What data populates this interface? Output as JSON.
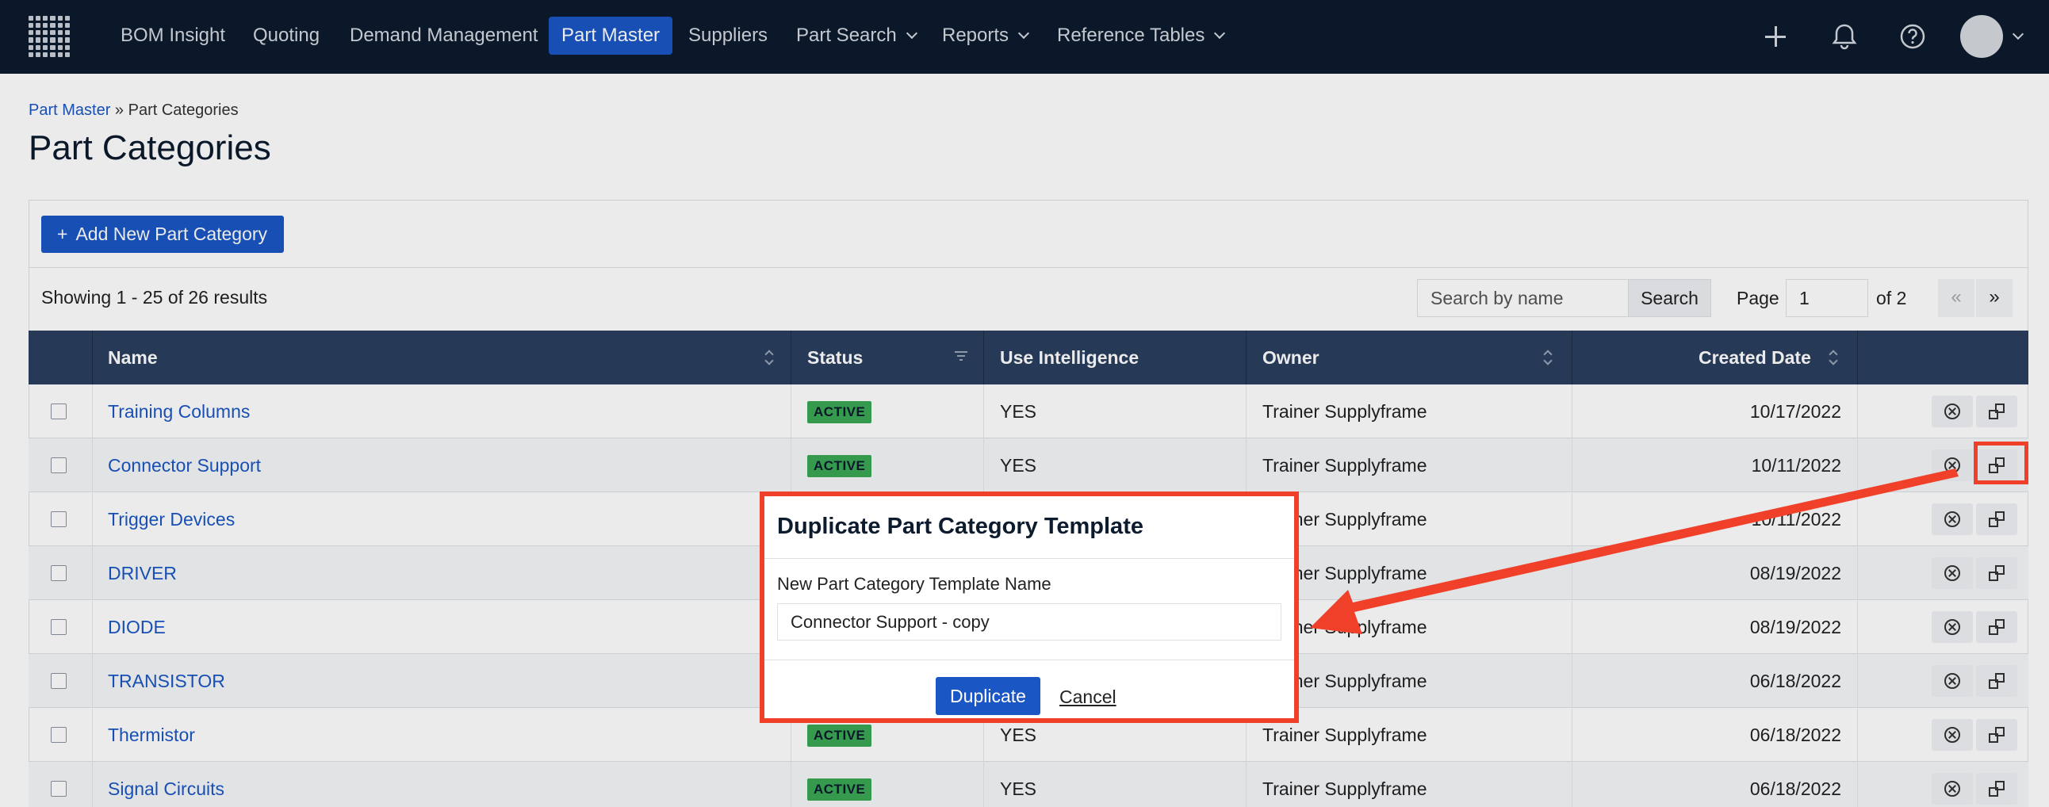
{
  "nav": {
    "items": [
      {
        "label": "BOM Insight",
        "dropdown": false,
        "active": false
      },
      {
        "label": "Quoting",
        "dropdown": false,
        "active": false
      },
      {
        "label": "Demand Management",
        "dropdown": false,
        "active": false
      },
      {
        "label": "Part Master",
        "dropdown": false,
        "active": true
      },
      {
        "label": "Suppliers",
        "dropdown": false,
        "active": false
      },
      {
        "label": "Part Search",
        "dropdown": true,
        "active": false
      },
      {
        "label": "Reports",
        "dropdown": true,
        "active": false
      },
      {
        "label": "Reference Tables",
        "dropdown": true,
        "active": false
      }
    ],
    "icons": [
      "plus-icon",
      "bell-icon",
      "help-icon",
      "avatar"
    ]
  },
  "breadcrumb": {
    "parent": "Part Master",
    "separator": "»",
    "current": "Part Categories"
  },
  "page": {
    "title": "Part Categories"
  },
  "toolbar": {
    "add_label": "Add New Part Category",
    "results": "Showing 1 - 25 of 26 results",
    "search_placeholder": "Search by name",
    "search_label": "Search",
    "page_label": "Page",
    "page_value": "1",
    "of_label": "of 2",
    "prev_label": "«",
    "next_label": "»"
  },
  "table": {
    "headers": {
      "name": "Name",
      "status": "Status",
      "use_intelligence": "Use Intelligence",
      "owner": "Owner",
      "created": "Created Date"
    },
    "rows": [
      {
        "name": "Training Columns",
        "status": "ACTIVE",
        "use_intelligence": "YES",
        "owner": "Trainer Supplyframe",
        "created": "10/17/2022"
      },
      {
        "name": "Connector Support",
        "status": "ACTIVE",
        "use_intelligence": "YES",
        "owner": "Trainer Supplyframe",
        "created": "10/11/2022"
      },
      {
        "name": "Trigger Devices",
        "status": "",
        "use_intelligence": "",
        "owner": "Trainer Supplyframe",
        "created": "10/11/2022"
      },
      {
        "name": "DRIVER",
        "status": "",
        "use_intelligence": "",
        "owner": "Trainer Supplyframe",
        "created": "08/19/2022"
      },
      {
        "name": "DIODE",
        "status": "",
        "use_intelligence": "",
        "owner": "Trainer Supplyframe",
        "created": "08/19/2022"
      },
      {
        "name": "TRANSISTOR",
        "status": "",
        "use_intelligence": "",
        "owner": "Trainer Supplyframe",
        "created": "06/18/2022"
      },
      {
        "name": "Thermistor",
        "status": "ACTIVE",
        "use_intelligence": "YES",
        "owner": "Trainer Supplyframe",
        "created": "06/18/2022"
      },
      {
        "name": "Signal Circuits",
        "status": "ACTIVE",
        "use_intelligence": "YES",
        "owner": "Trainer Supplyframe",
        "created": "06/18/2022"
      }
    ]
  },
  "modal": {
    "title": "Duplicate Part Category Template",
    "field_label": "New Part Category Template Name",
    "field_value": "Connector Support - copy",
    "duplicate_label": "Duplicate",
    "cancel_label": "Cancel"
  },
  "colors": {
    "nav_bg": "#0d1b2e",
    "accent": "#1a56c4",
    "header_bg": "#2a3f5f",
    "badge": "#3aa655",
    "annotation": "#f0402a"
  }
}
